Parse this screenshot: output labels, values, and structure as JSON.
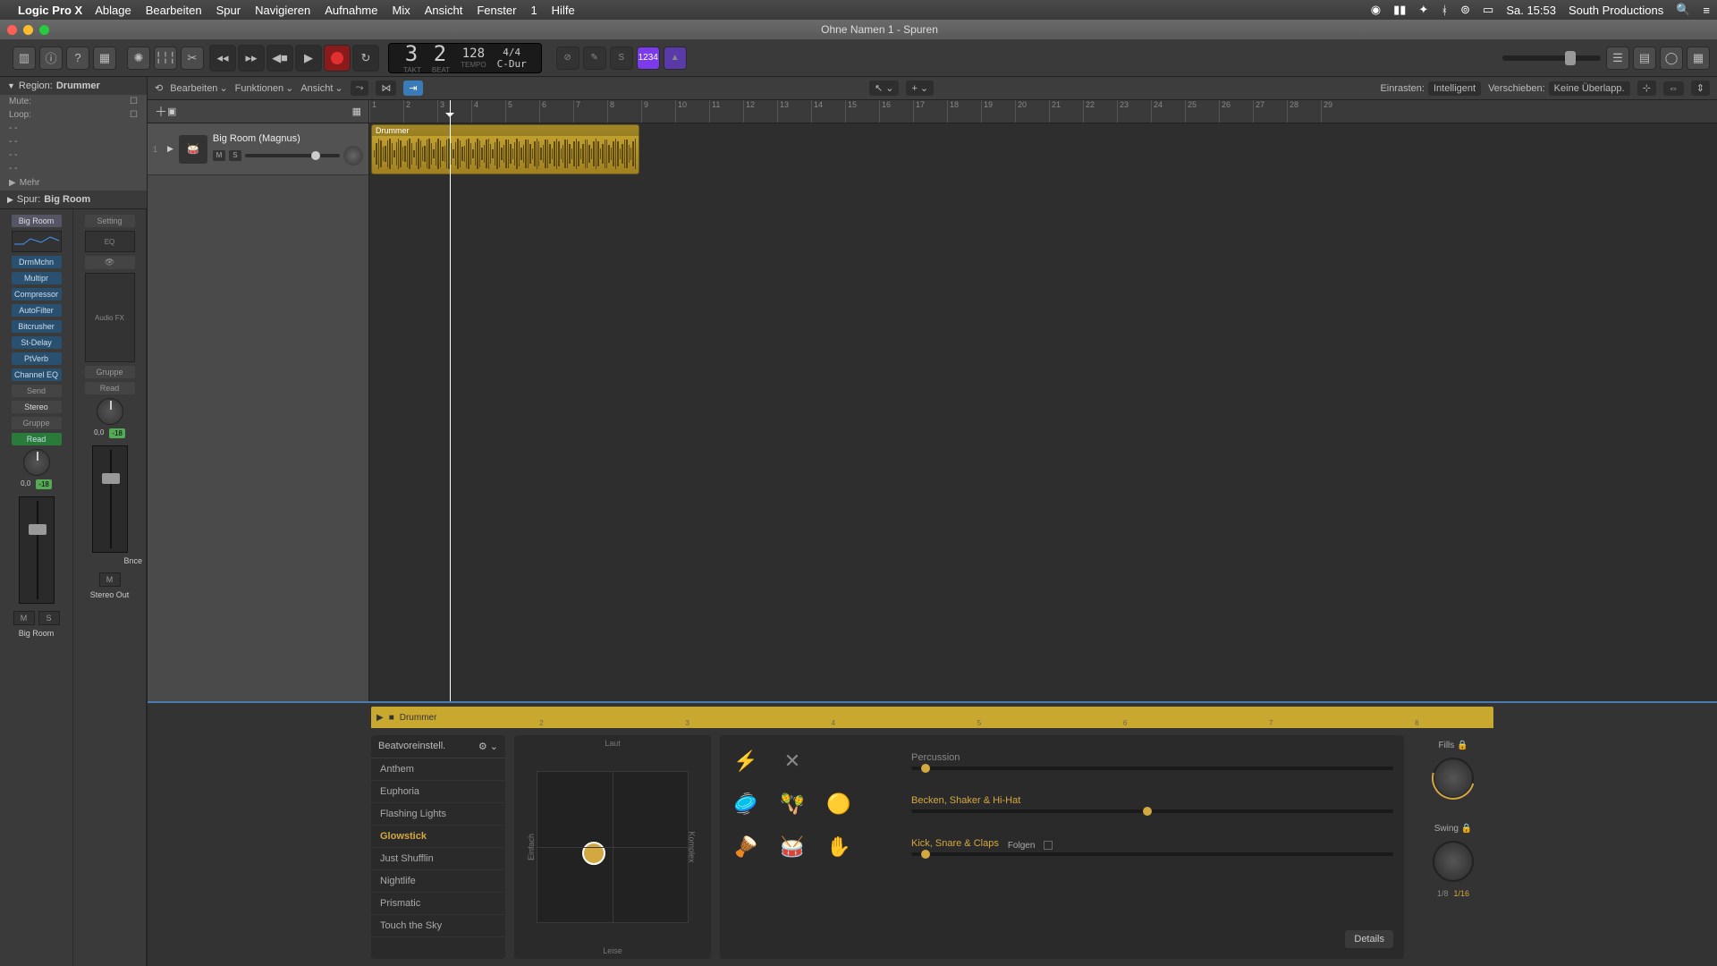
{
  "menubar": {
    "app": "Logic Pro X",
    "items": [
      "Ablage",
      "Bearbeiten",
      "Spur",
      "Navigieren",
      "Aufnahme",
      "Mix",
      "Ansicht",
      "Fenster",
      "1",
      "Hilfe"
    ],
    "clock": "Sa. 15:53",
    "user": "South Productions"
  },
  "window": {
    "title": "Ohne Namen 1 - Spuren"
  },
  "lcd": {
    "bar": "3",
    "beat": "2",
    "bar_lbl": "TAKT",
    "beat_lbl": "BEAT",
    "tempo": "128",
    "tempo_lbl": "TEMPO",
    "sig": "4/4",
    "key": "C-Dur"
  },
  "mode_badge": "1234",
  "tracks_toolbar": {
    "menus": [
      "Bearbeiten",
      "Funktionen",
      "Ansicht"
    ],
    "snap_lbl": "Einrasten:",
    "snap_val": "Intelligent",
    "move_lbl": "Verschieben:",
    "move_val": "Keine Überlapp."
  },
  "inspector": {
    "region_hdr": "Region:",
    "region_name": "Drummer",
    "mute_lbl": "Mute:",
    "loop_lbl": "Loop:",
    "mehr": "Mehr",
    "spur_hdr": "Spur:",
    "spur_name": "Big Room"
  },
  "strip1": {
    "name": "Big Room",
    "setting": "Setting",
    "inst": "DrmMchn",
    "plugins": [
      "Multipr",
      "Compressor",
      "AutoFilter",
      "Bitcrusher",
      "St-Delay",
      "PtVerb",
      "Channel EQ"
    ],
    "send": "Send",
    "stereo": "Stereo",
    "gruppe": "Gruppe",
    "read": "Read",
    "db": "0,0",
    "peak": "-18",
    "m": "M",
    "s": "S",
    "out": "Big Room"
  },
  "strip2": {
    "setting": "Setting",
    "eq": "EQ",
    "audiofx": "Audio FX",
    "gruppe": "Gruppe",
    "read": "Read",
    "db": "0,0",
    "peak": "-18",
    "m": "M",
    "bnce": "Bnce",
    "out": "Stereo Out"
  },
  "track": {
    "num": "1",
    "name": "Big Room (Magnus)",
    "m": "M",
    "s": "S"
  },
  "region": {
    "name": "Drummer"
  },
  "ruler": [
    "1",
    "2",
    "3",
    "4",
    "5",
    "6",
    "7",
    "8",
    "9",
    "10",
    "11",
    "12",
    "13",
    "14",
    "15",
    "16",
    "17",
    "18",
    "19",
    "20",
    "21",
    "22",
    "23",
    "24",
    "25",
    "26",
    "27",
    "28",
    "29"
  ],
  "drummer": {
    "title": "Drummer",
    "preview_ticks": [
      "2",
      "3",
      "4",
      "5",
      "6",
      "7",
      "8"
    ],
    "preset_hdr": "Beatvoreinstell.",
    "presets": [
      "Anthem",
      "Euphoria",
      "Flashing Lights",
      "Glowstick",
      "Just Shufflin",
      "Nightlife",
      "Prismatic",
      "Touch the Sky"
    ],
    "preset_sel": "Glowstick",
    "xy": {
      "laut": "Laut",
      "leise": "Leise",
      "einfach": "Einfach",
      "komplex": "Komplex"
    },
    "rows": {
      "perc": "Percussion",
      "bsh": "Becken, Shaker & Hi-Hat",
      "ksc": "Kick, Snare & Claps",
      "folgen": "Folgen"
    },
    "fills": "Fills",
    "swing": "Swing",
    "swing_opts": [
      "1/8",
      "1/16"
    ],
    "swing_sel": "1/16",
    "details": "Details"
  }
}
